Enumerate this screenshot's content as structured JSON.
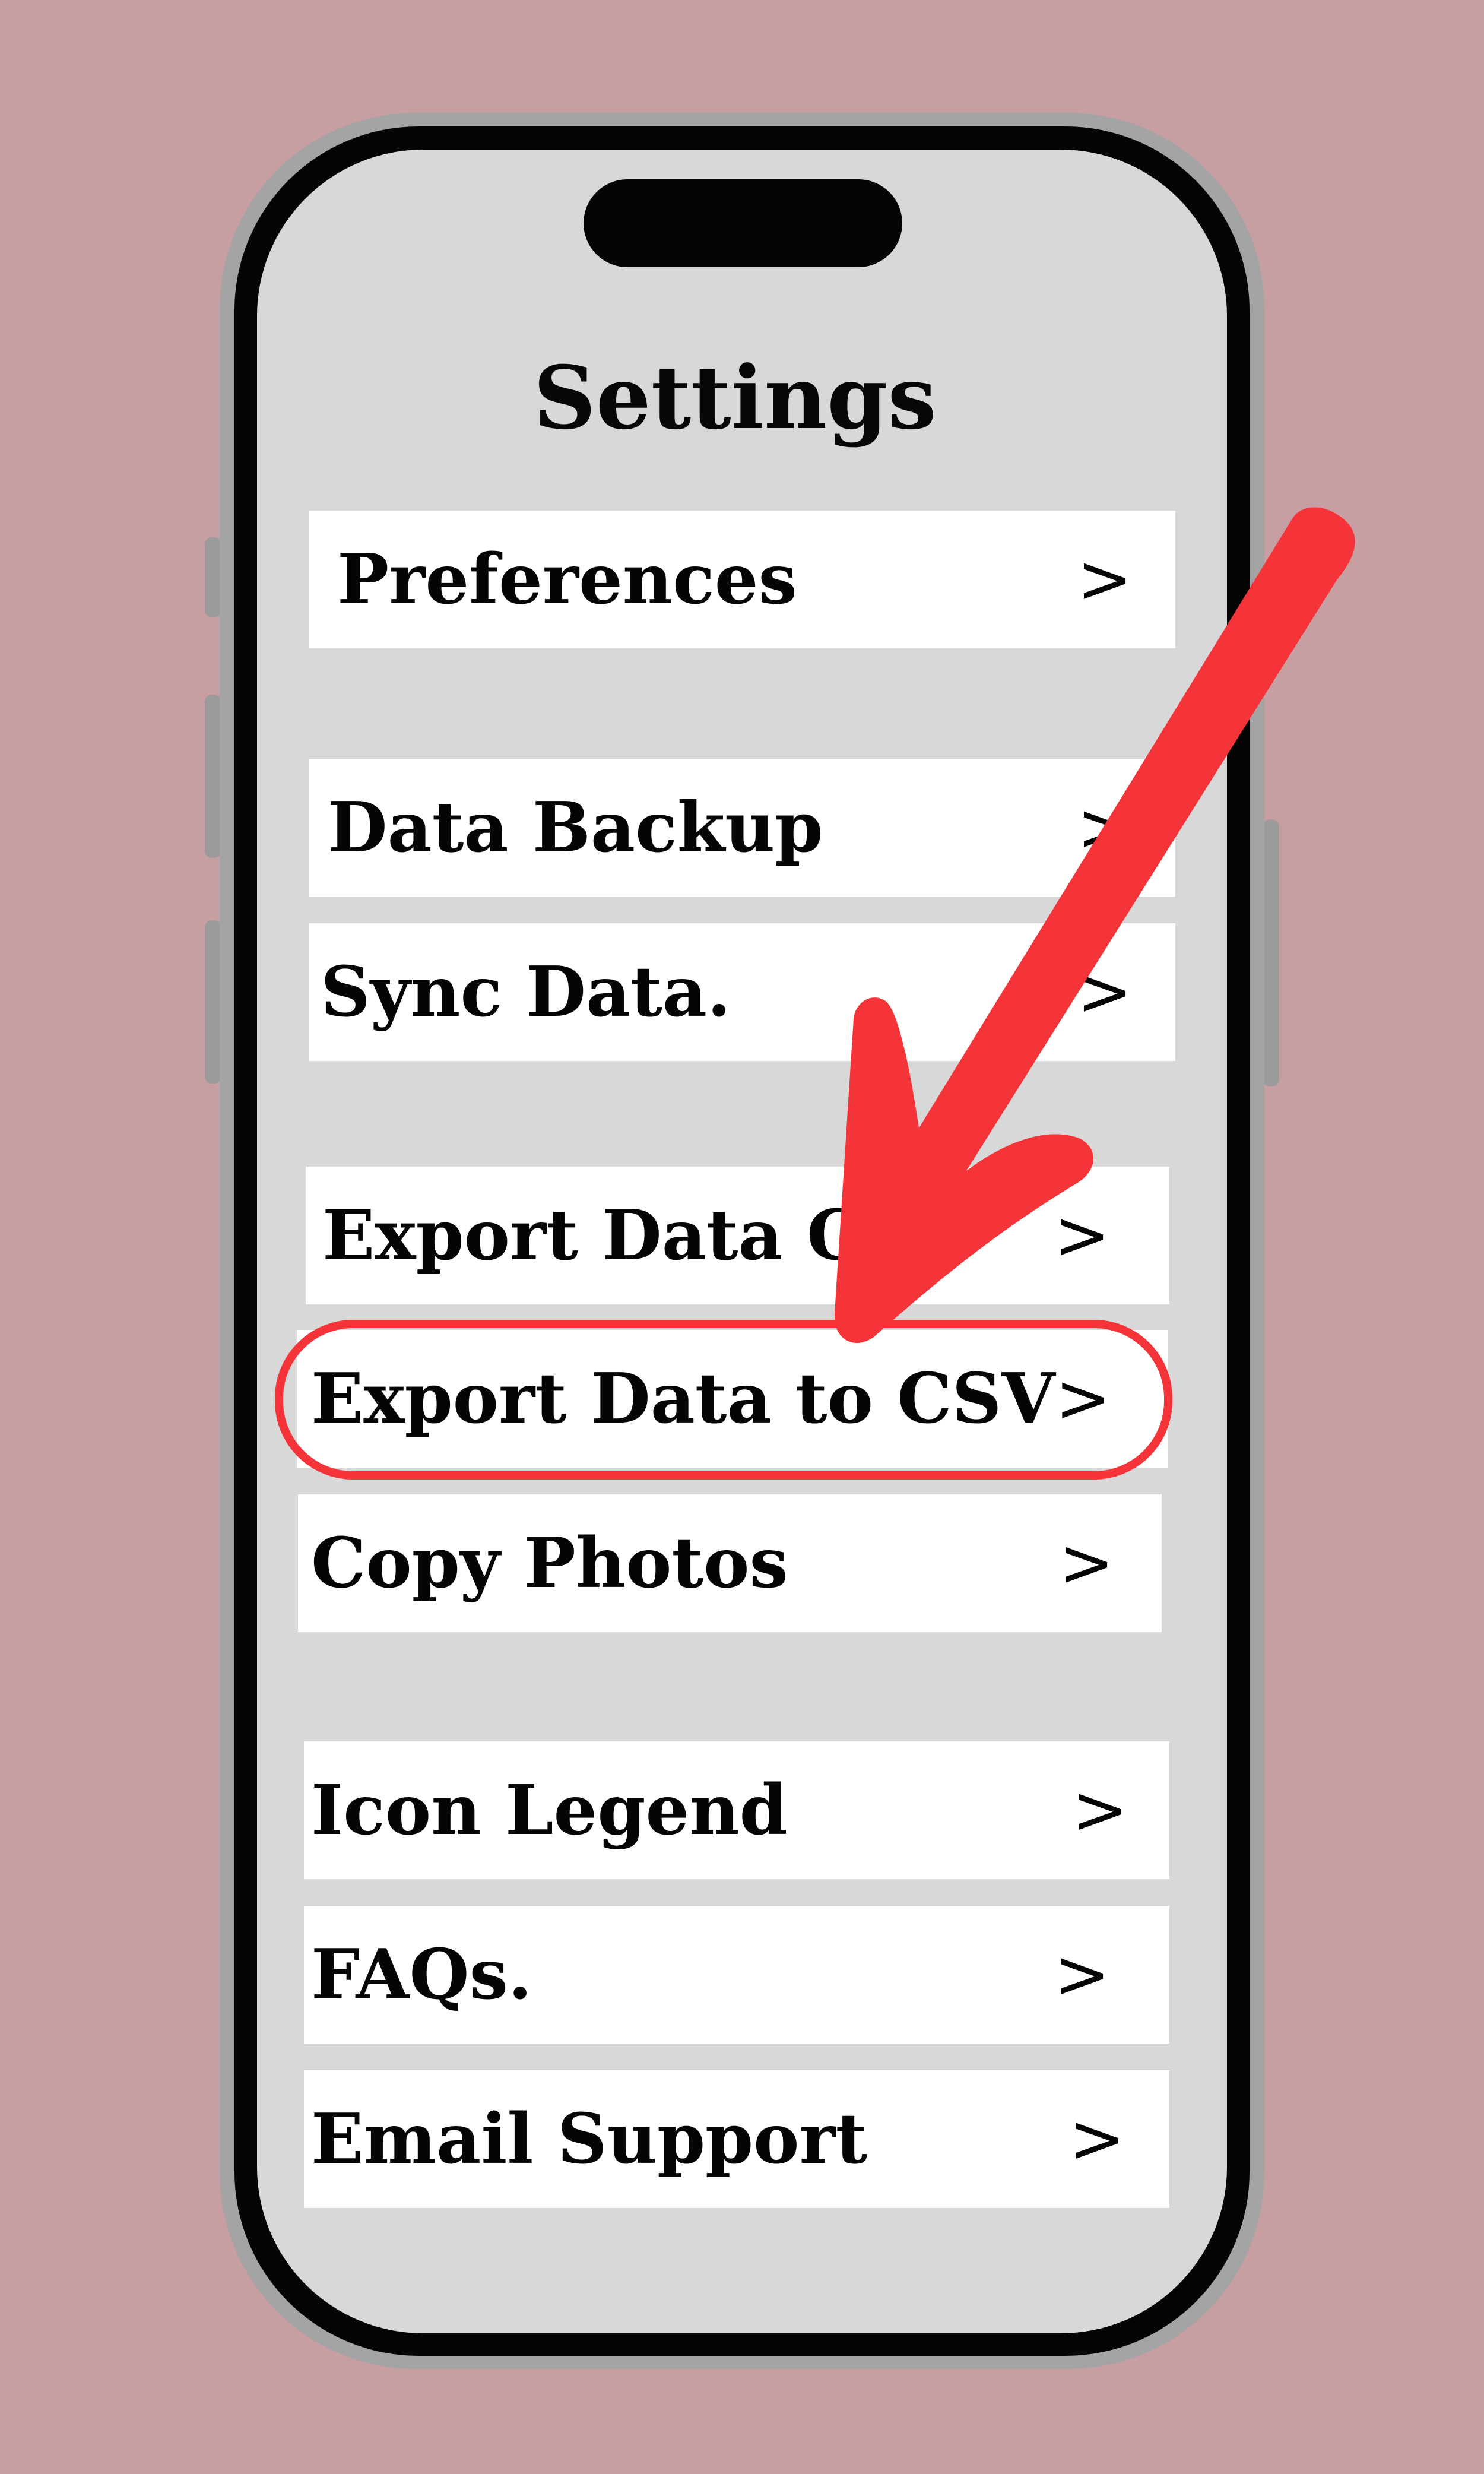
{
  "screen": {
    "title": "Settings"
  },
  "settings": {
    "items": [
      {
        "label": "Preferences",
        "chevron": ">"
      },
      {
        "label": "Data Backup",
        "chevron": ">"
      },
      {
        "label": "Sync Data.",
        "chevron": ">"
      },
      {
        "label": "Export Data Clo",
        "chevron": ">"
      },
      {
        "label": "Export Data to CSV",
        "chevron": ">"
      },
      {
        "label": "Copy Photos",
        "chevron": ">"
      },
      {
        "label": "Icon Legend",
        "chevron": ">"
      },
      {
        "label": "FAQs.",
        "chevron": ">"
      },
      {
        "label": "Email Support",
        "chevron": ">"
      }
    ]
  },
  "colors": {
    "background": "#c79ea2",
    "screen": "#d8d8d8",
    "row": "#ffffff",
    "annotation": "#f43438"
  }
}
